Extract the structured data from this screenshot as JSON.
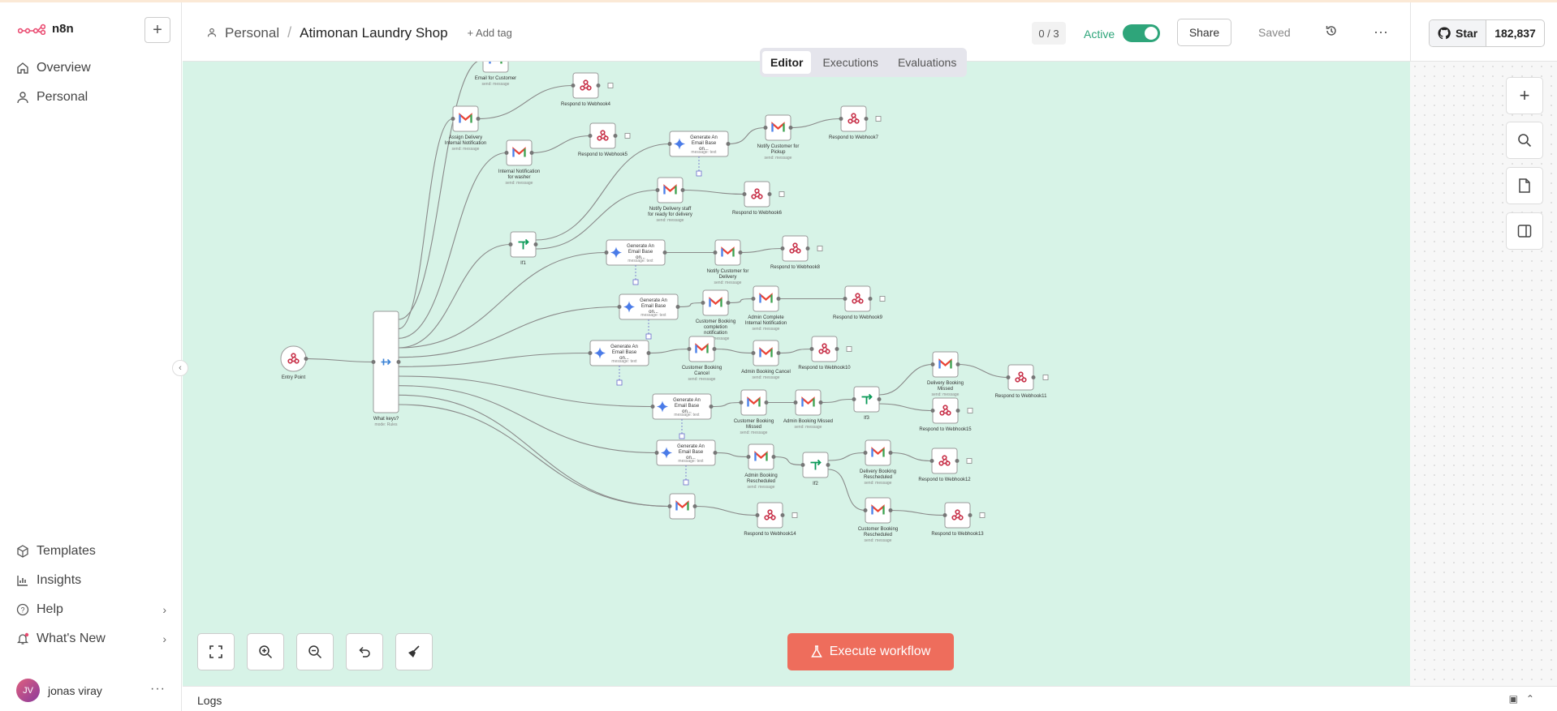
{
  "app": {
    "name": "n8n"
  },
  "sidebar": {
    "items": [
      {
        "label": "Overview",
        "icon": "home-icon"
      },
      {
        "label": "Personal",
        "icon": "user-icon"
      }
    ],
    "bottom": [
      {
        "label": "Templates",
        "icon": "templates-icon"
      },
      {
        "label": "Insights",
        "icon": "chart-icon"
      },
      {
        "label": "Help",
        "icon": "help-icon"
      },
      {
        "label": "What's New",
        "icon": "bell-icon"
      }
    ],
    "user": {
      "initials": "JV",
      "name": "jonas viray"
    }
  },
  "header": {
    "breadcrumb_project": "Personal",
    "breadcrumb_sep": "/",
    "workflow_name": "Atimonan Laundry Shop",
    "add_tag": "+ Add tag",
    "counter": "0 / 3",
    "active_label": "Active",
    "active": true,
    "share": "Share",
    "saved": "Saved"
  },
  "github": {
    "star": "Star",
    "count": "182,837"
  },
  "tabs": [
    {
      "label": "Editor",
      "selected": true
    },
    {
      "label": "Executions",
      "selected": false
    },
    {
      "label": "Evaluations",
      "selected": false
    }
  ],
  "execute": {
    "label": "Execute workflow"
  },
  "logs": {
    "label": "Logs"
  },
  "colors": {
    "canvas": "#d7f3e7",
    "accent": "#ee6d5c",
    "active": "#2ea57a"
  },
  "workflow": {
    "nodes": [
      {
        "type": "webhook",
        "label": "Entry Point",
        "sub": ""
      },
      {
        "type": "switch",
        "label": "What keys?",
        "sub": "mode: Rules"
      },
      {
        "type": "gmail",
        "label": "Email for Customer",
        "sub": "send: message"
      },
      {
        "type": "respond",
        "label": "Respond to Webhook4",
        "sub": ""
      },
      {
        "type": "gmail",
        "label": "Assign Delivery Internal Notification",
        "sub": "send: message"
      },
      {
        "type": "respond",
        "label": "Respond to Webhook5",
        "sub": ""
      },
      {
        "type": "gmail",
        "label": "Internal Notification for washer",
        "sub": "send: message"
      },
      {
        "type": "gemini",
        "label": "Generate An Email Base on...",
        "sub": "message: text"
      },
      {
        "type": "gmail",
        "label": "Notify Customer for Pickup",
        "sub": "send: message"
      },
      {
        "type": "respond",
        "label": "Respond to Webhook7",
        "sub": ""
      },
      {
        "type": "gmail",
        "label": "Notify Delivery staff for ready for delivery",
        "sub": "send: message"
      },
      {
        "type": "respond",
        "label": "Respond to Webhook6",
        "sub": ""
      },
      {
        "type": "if",
        "label": "If1",
        "sub": ""
      },
      {
        "type": "gemini",
        "label": "Generate An Email Base on...",
        "sub": "message: text"
      },
      {
        "type": "gmail",
        "label": "Notify Customer for Delivery",
        "sub": "send: message"
      },
      {
        "type": "respond",
        "label": "Respond to Webhook8",
        "sub": ""
      },
      {
        "type": "gemini",
        "label": "Generate An Email Base on...",
        "sub": "message: text"
      },
      {
        "type": "gmail",
        "label": "Customer Booking completion notification",
        "sub": "send: message"
      },
      {
        "type": "gmail",
        "label": "Admin Complete Internal Notification",
        "sub": "send: message"
      },
      {
        "type": "respond",
        "label": "Respond to Webhook9",
        "sub": ""
      },
      {
        "type": "gemini",
        "label": "Generate An Email Base on...",
        "sub": "message: text"
      },
      {
        "type": "gmail",
        "label": "Customer Booking Cancel",
        "sub": "send: message"
      },
      {
        "type": "gmail",
        "label": "Admin Booking Cancel",
        "sub": "send: message"
      },
      {
        "type": "respond",
        "label": "Respond to Webhook10",
        "sub": ""
      },
      {
        "type": "gemini",
        "label": "Generate An Email Base on...",
        "sub": "message: text"
      },
      {
        "type": "gmail",
        "label": "Customer Booking Missed",
        "sub": "send: message"
      },
      {
        "type": "gmail",
        "label": "Admin Booking Missed",
        "sub": "send: message"
      },
      {
        "type": "if",
        "label": "If3",
        "sub": ""
      },
      {
        "type": "gmail",
        "label": "Delivery Booking Missed",
        "sub": "send: message"
      },
      {
        "type": "respond",
        "label": "Respond to Webhook11",
        "sub": ""
      },
      {
        "type": "respond",
        "label": "Respond to Webhook15",
        "sub": ""
      },
      {
        "type": "gemini",
        "label": "Generate An Email Base on...",
        "sub": "message: text"
      },
      {
        "type": "gmail",
        "label": "Admin Booking Rescheduled",
        "sub": "send: message"
      },
      {
        "type": "if",
        "label": "If2",
        "sub": ""
      },
      {
        "type": "gmail",
        "label": "Delivery Booking Rescheduled",
        "sub": "send: message"
      },
      {
        "type": "respond",
        "label": "Respond to Webhook12",
        "sub": ""
      },
      {
        "type": "gmail",
        "label": "Customer Booking Rescheduled",
        "sub": "send: message"
      },
      {
        "type": "respond",
        "label": "Respond to Webhook13",
        "sub": ""
      },
      {
        "type": "gmail",
        "label": "",
        "sub": ""
      },
      {
        "type": "respond",
        "label": "Respond to Webhook14",
        "sub": ""
      }
    ]
  }
}
